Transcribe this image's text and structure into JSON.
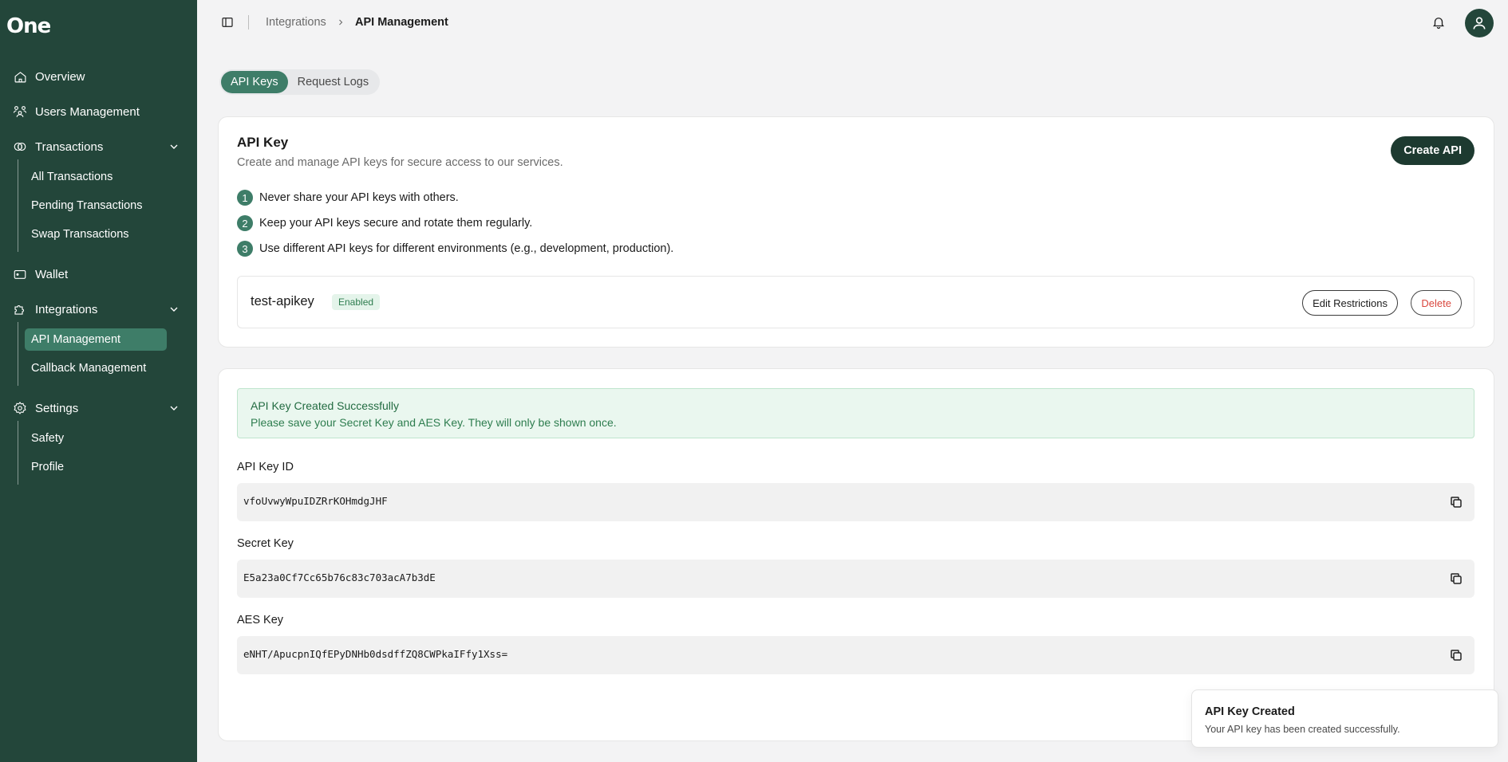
{
  "brand": {
    "logo": "One",
    "sidebar_color": "#23463a",
    "accent": "#3e7d68"
  },
  "sidebar": {
    "overview": "Overview",
    "users": "Users Management",
    "transactions": "Transactions",
    "transactions_sub": [
      "All Transactions",
      "Pending Transactions",
      "Swap Transactions"
    ],
    "wallet": "Wallet",
    "integrations": "Integrations",
    "integrations_sub": [
      "API Management",
      "Callback Management"
    ],
    "settings": "Settings",
    "settings_sub": [
      "Safety",
      "Profile"
    ],
    "active_item": "API Management"
  },
  "header": {
    "breadcrumb_parent": "Integrations",
    "breadcrumb_current": "API Management"
  },
  "tabs": [
    {
      "label": "API Keys",
      "active": true
    },
    {
      "label": "Request Logs",
      "active": false
    }
  ],
  "api_key_card": {
    "title": "API Key",
    "description": "Create and manage API keys for secure access to our services.",
    "create_button": "Create API",
    "rules": [
      {
        "num": "1",
        "text": "Never share your API keys with others."
      },
      {
        "num": "2",
        "text": "Keep your API keys secure and rotate them regularly."
      },
      {
        "num": "3",
        "text": "Use different API keys for different environments (e.g., development, production)."
      }
    ],
    "key": {
      "name": "test-apikey",
      "status": "Enabled",
      "edit_button": "Edit Restrictions",
      "delete_button": "Delete"
    }
  },
  "created_card": {
    "alert_title": "API Key Created Successfully",
    "alert_message": "Please save your Secret Key and AES Key. They will only be shown once.",
    "fields": [
      {
        "label": "API Key ID",
        "value": "vfoUvwyWpuIDZRrKOHmdgJHF"
      },
      {
        "label": "Secret Key",
        "value": "E5a23a0Cf7Cc65b76c83c703acA7b3dE"
      },
      {
        "label": "AES Key",
        "value": "eNHT/ApucpnIQfEPyDNHb0dsdffZQ8CWPkaIFfy1Xss="
      }
    ]
  },
  "toast": {
    "title": "API Key Created",
    "message": "Your API key has been created successfully."
  }
}
